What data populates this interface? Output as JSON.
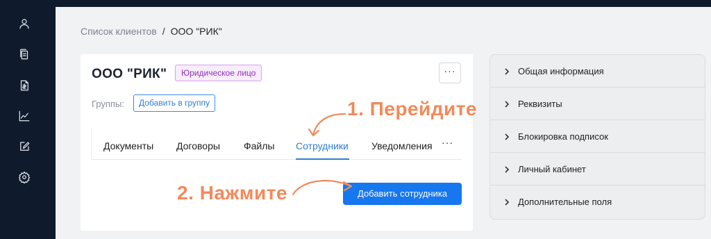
{
  "sidebar": {
    "icons": [
      "user-icon",
      "documents-icon",
      "contract-icon",
      "chart-icon",
      "edit-icon",
      "gear-icon"
    ]
  },
  "breadcrumb": {
    "parent": "Список клиентов",
    "separator": "/",
    "current": "ООО \"РИК\""
  },
  "card": {
    "title": "ООО \"РИК\"",
    "type_badge": "Юридическое лицо",
    "more": "···",
    "groups_label": "Группы:",
    "add_group": "Добавить в группу"
  },
  "tabs": {
    "items": [
      "Документы",
      "Договоры",
      "Файлы",
      "Сотрудники",
      "Уведомления"
    ],
    "active": "Сотрудники",
    "more": "···"
  },
  "actions": {
    "add_employee": "Добавить сотрудника"
  },
  "annotations": {
    "step1": "1. Перейдите",
    "step2": "2. Нажмите",
    "color": "#f28a5a"
  },
  "right_panel": {
    "items": [
      "Общая информация",
      "Реквизиты",
      "Блокировка подписок",
      "Личный кабинет",
      "Дополнительные поля"
    ]
  },
  "colors": {
    "sidebar": "#0f1b2d",
    "accent": "#1677ef",
    "badge_text": "#8b34b8"
  }
}
